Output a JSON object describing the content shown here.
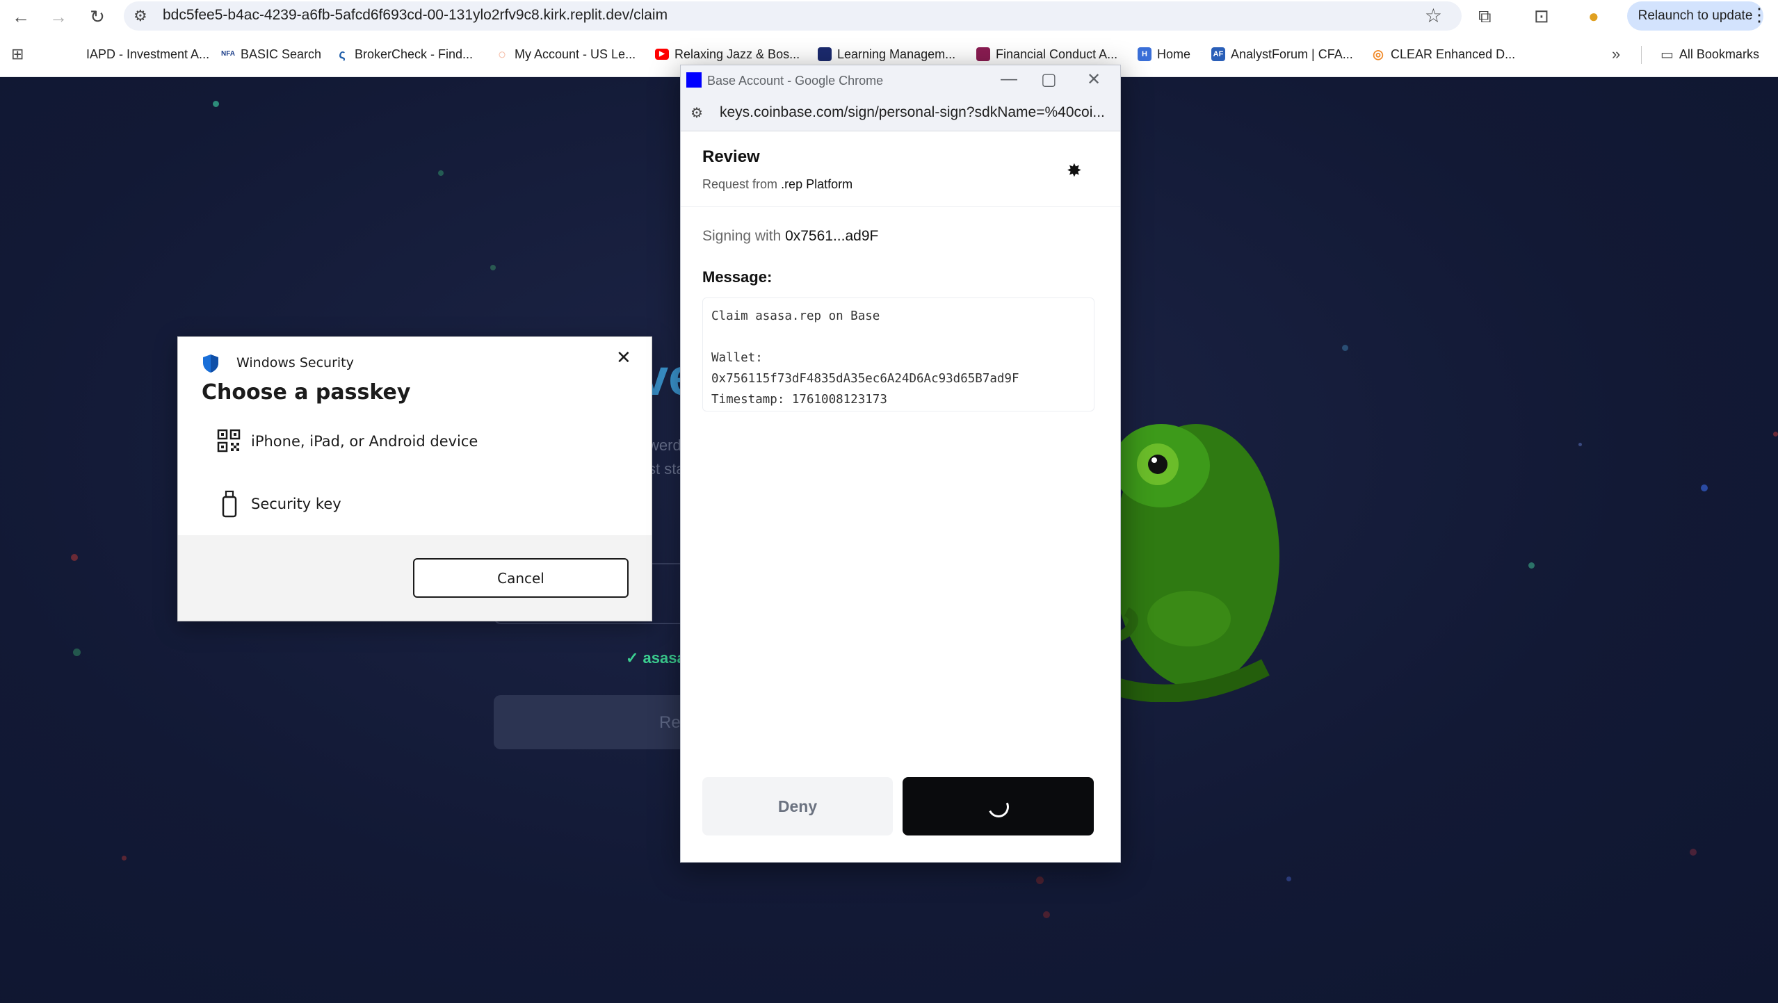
{
  "browser": {
    "url": "bdc5fee5-b4ac-4239-a6fb-5afcd6f693cd-00-131ylo2rfv9c8.kirk.replit.dev/claim",
    "relaunch_label": "Relaunch to update",
    "bookmarks": [
      {
        "label": "IAPD - Investment A...",
        "color": "#ffffff"
      },
      {
        "label": "BASIC Search",
        "color": "#1d3f8a"
      },
      {
        "label": "BrokerCheck - Find...",
        "color": "#1d5ca8"
      },
      {
        "label": "My Account - US Le...",
        "color": "#e86a3a"
      },
      {
        "label": "Relaxing Jazz & Bos...",
        "color": "#ff0000"
      },
      {
        "label": "Learning Managem...",
        "color": "#1b2a6e"
      },
      {
        "label": "Financial Conduct A...",
        "color": "#8a1c52"
      },
      {
        "label": "Home",
        "color": "#3a6fd8"
      },
      {
        "label": "AnalystForum | CFA...",
        "color": "#2a5fb8"
      },
      {
        "label": "CLEAR Enhanced D...",
        "color": "#f08a2a"
      }
    ],
    "all_bookmarks_label": "All Bookmarks"
  },
  "background_page": {
    "heading_fragment": "ve",
    "line1_fragment": "werd",
    "line2_fragment": "st sta",
    "check_text": "✓ asasa.",
    "button_fragment": "Re"
  },
  "windows_security": {
    "title": "Windows Security",
    "heading": "Choose a passkey",
    "options": [
      {
        "label": "iPhone, iPad, or Android device",
        "icon": "qr-code-icon"
      },
      {
        "label": "Security key",
        "icon": "usb-key-icon"
      }
    ],
    "cancel_label": "Cancel"
  },
  "popup": {
    "window_title": "Base Account - Google Chrome",
    "url": "keys.coinbase.com/sign/personal-sign?sdkName=%40coi...",
    "review_title": "Review",
    "request_prefix": "Request from",
    "request_source": ".rep Platform",
    "signing_prefix": "Signing with",
    "signing_address": "0x7561...ad9F",
    "message_label": "Message:",
    "message_lines": [
      "Claim asasa.rep on Base",
      "",
      "Wallet:",
      "0x756115f73dF4835dA35ec6A24D6Ac93d65B7ad9F",
      "Timestamp: 1761008123173"
    ],
    "deny_label": "Deny",
    "accent_color": "#0000ff"
  }
}
